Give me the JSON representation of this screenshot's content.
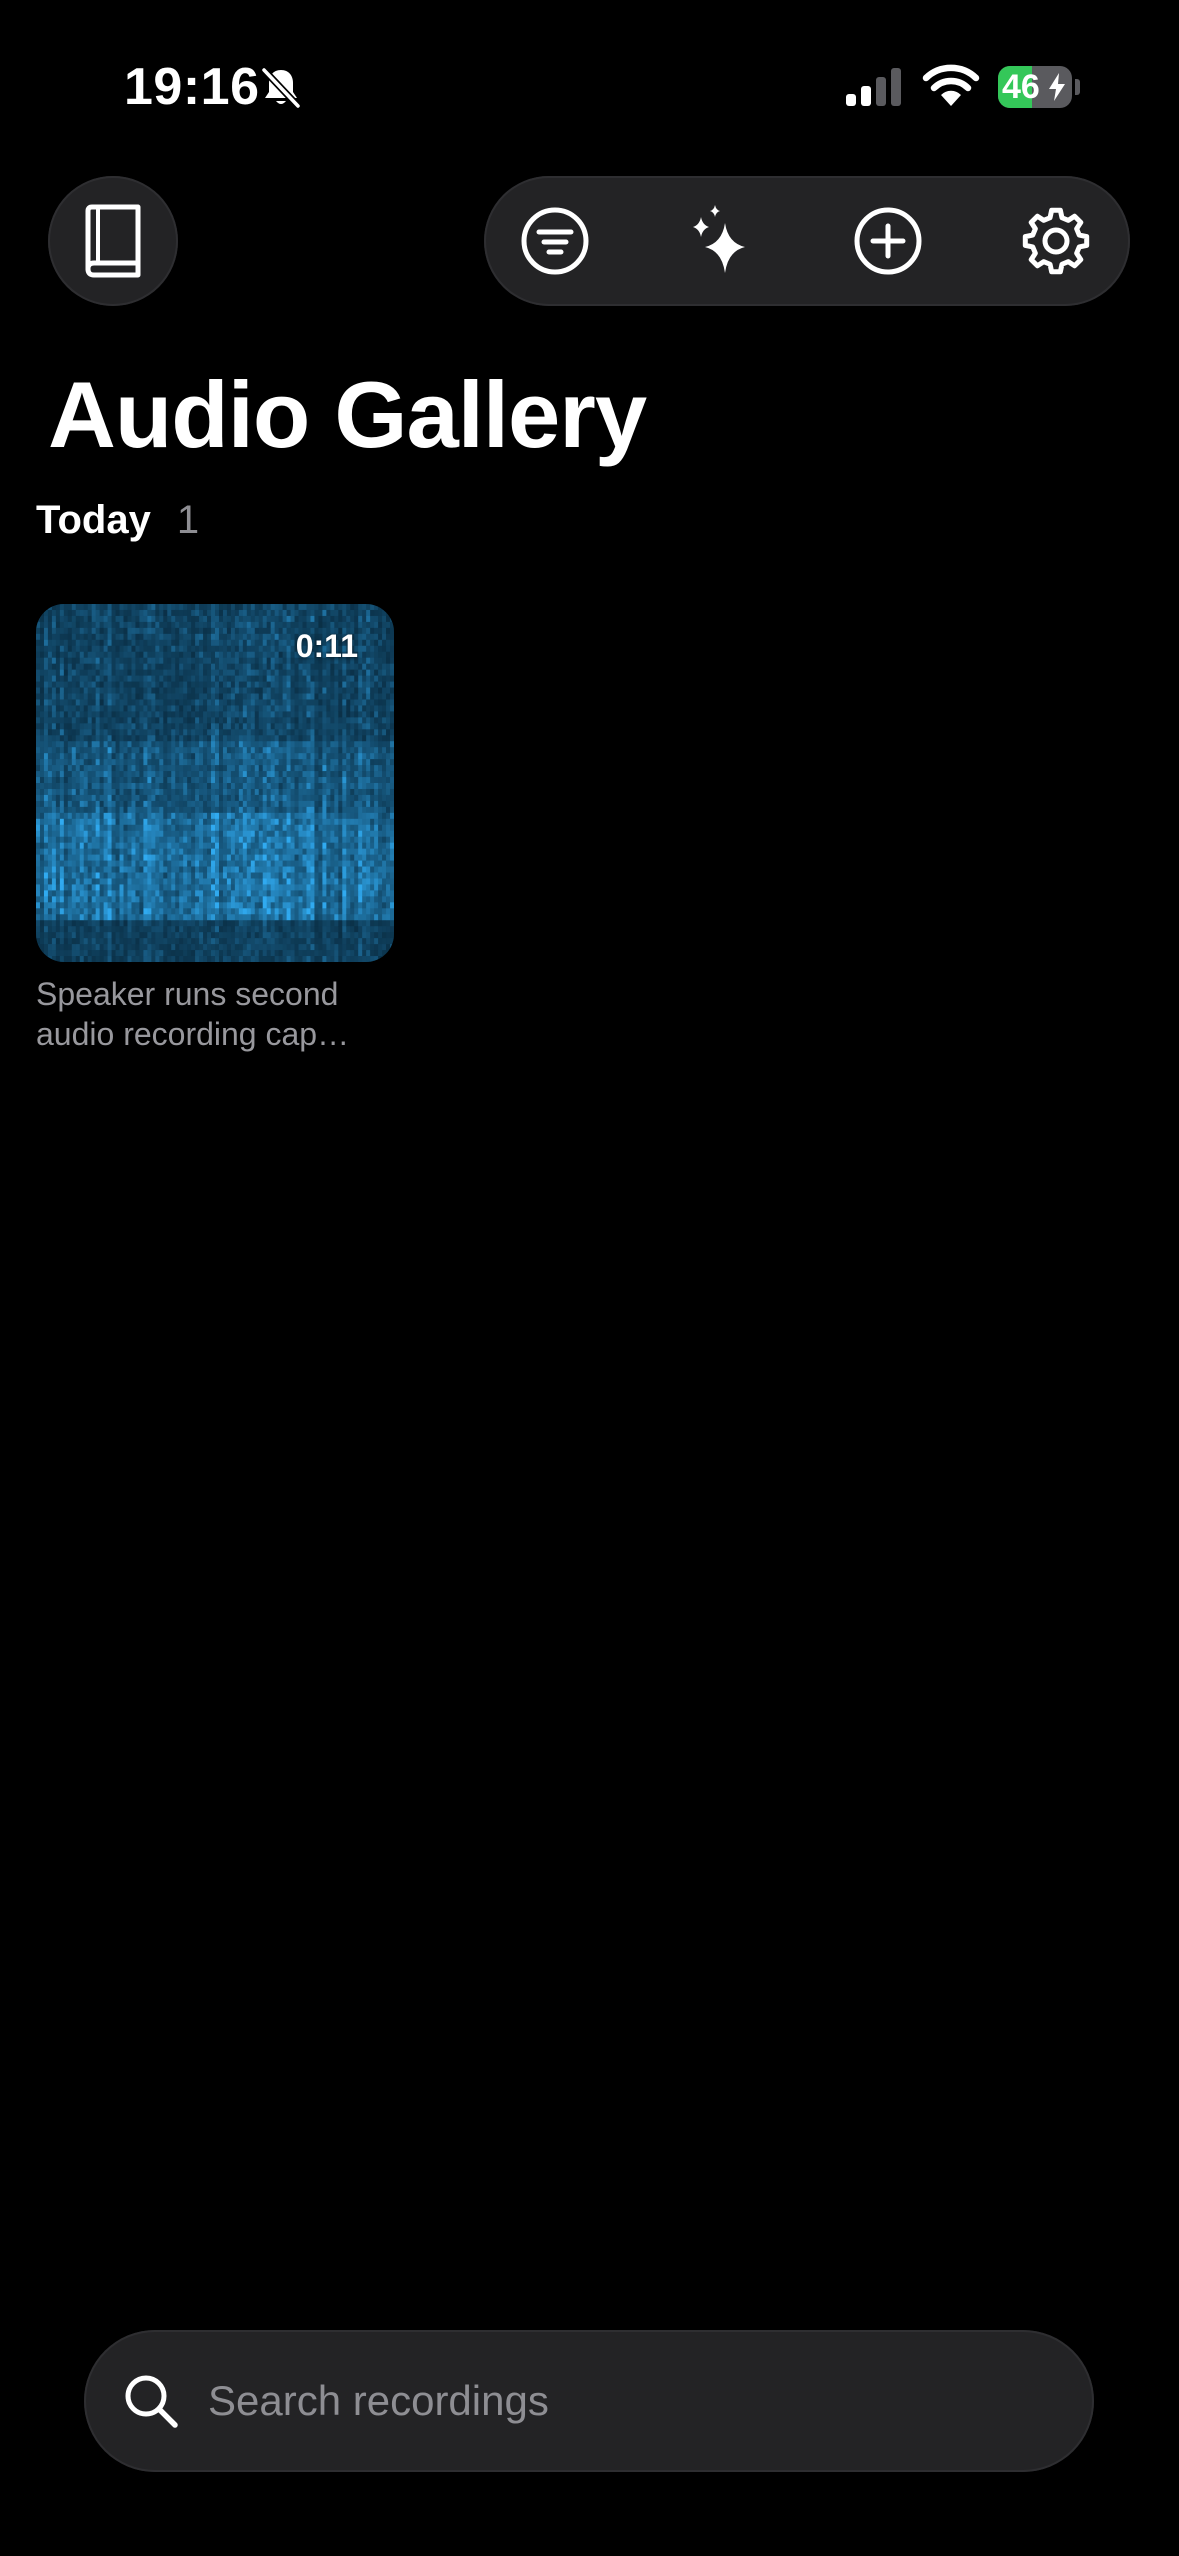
{
  "status_bar": {
    "time": "19:16",
    "battery_level": "46",
    "battery_percent": 46,
    "icons": [
      "bell-slash-icon",
      "cellular-signal-icon",
      "wifi-icon",
      "battery-charging-icon"
    ]
  },
  "header": {
    "library_icon": "book-icon",
    "toolbar_icons": [
      "filter-icon",
      "sparkles-icon",
      "add-circle-icon",
      "gear-icon"
    ]
  },
  "page": {
    "title": "Audio Gallery"
  },
  "sections": [
    {
      "label": "Today",
      "count": "1",
      "recordings": [
        {
          "duration": "0:11",
          "caption": "Speaker runs second audio recording cap…",
          "thumbnail": "spectrogram"
        }
      ]
    }
  ],
  "search": {
    "placeholder": "Search recordings",
    "value": ""
  },
  "colors": {
    "background": "#000000",
    "surface": "#232325",
    "secondary_text": "#8e8e93",
    "battery_green": "#34c759",
    "spectrogram_blue": "#1e8fd6"
  }
}
